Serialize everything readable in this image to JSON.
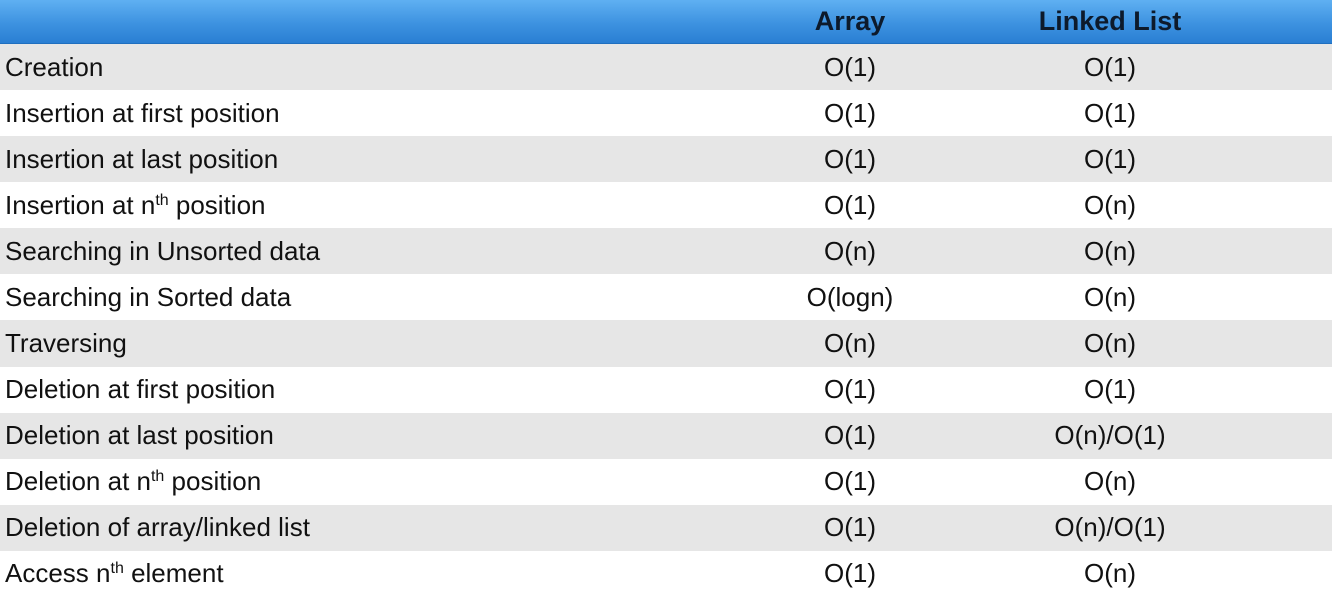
{
  "header": {
    "col_label": "",
    "col_array": "Array",
    "col_linked_list": "Linked List"
  },
  "rows": [
    {
      "label_pre": "Creation",
      "sup": "",
      "label_post": "",
      "array": "O(1)",
      "linked_list": "O(1)"
    },
    {
      "label_pre": "Insertion at first position",
      "sup": "",
      "label_post": "",
      "array": "O(1)",
      "linked_list": "O(1)"
    },
    {
      "label_pre": "Insertion at last position",
      "sup": "",
      "label_post": "",
      "array": "O(1)",
      "linked_list": "O(1)"
    },
    {
      "label_pre": "Insertion at n",
      "sup": "th",
      "label_post": " position",
      "array": "O(1)",
      "linked_list": "O(n)"
    },
    {
      "label_pre": "Searching in Unsorted data",
      "sup": "",
      "label_post": "",
      "array": "O(n)",
      "linked_list": "O(n)"
    },
    {
      "label_pre": "Searching in Sorted data",
      "sup": "",
      "label_post": "",
      "array": "O(logn)",
      "linked_list": "O(n)"
    },
    {
      "label_pre": "Traversing",
      "sup": "",
      "label_post": "",
      "array": "O(n)",
      "linked_list": "O(n)"
    },
    {
      "label_pre": "Deletion at first position",
      "sup": "",
      "label_post": "",
      "array": "O(1)",
      "linked_list": "O(1)"
    },
    {
      "label_pre": "Deletion at last position",
      "sup": "",
      "label_post": "",
      "array": "O(1)",
      "linked_list": "O(n)/O(1)"
    },
    {
      "label_pre": "Deletion at n",
      "sup": "th",
      "label_post": " position",
      "array": "O(1)",
      "linked_list": "O(n)"
    },
    {
      "label_pre": "Deletion of array/linked list",
      "sup": "",
      "label_post": "",
      "array": "O(1)",
      "linked_list": "O(n)/O(1)"
    },
    {
      "label_pre": "Access n",
      "sup": "th",
      "label_post": " element",
      "array": "O(1)",
      "linked_list": "O(n)"
    }
  ]
}
